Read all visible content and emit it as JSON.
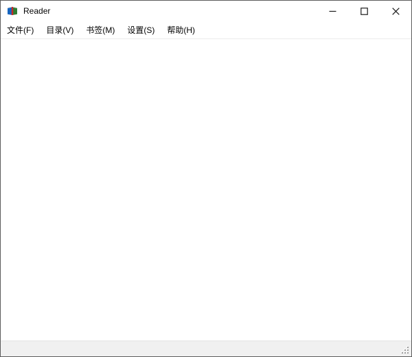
{
  "window": {
    "title": "Reader",
    "app_icon": "book-icon"
  },
  "titlebar": {
    "controls": [
      {
        "name": "minimize",
        "icon": "minimize-icon"
      },
      {
        "name": "maximize",
        "icon": "maximize-icon"
      },
      {
        "name": "close",
        "icon": "close-icon"
      }
    ]
  },
  "menubar": {
    "items": [
      {
        "label": "文件(F)"
      },
      {
        "label": "目录(V)"
      },
      {
        "label": "书签(M)"
      },
      {
        "label": "设置(S)"
      },
      {
        "label": "帮助(H)"
      }
    ]
  },
  "statusbar": {
    "grip_icon": "resize-grip-icon"
  },
  "colors": {
    "window_border": "#5b5b5b",
    "titlebar_bg": "#ffffff",
    "menubar_bg": "#ffffff",
    "content_bg": "#ffffff",
    "statusbar_bg": "#f0f0f0",
    "menu_separator": "#ececec",
    "glyph": "#1a1a1a",
    "book_blue": "#1565c0",
    "book_green": "#2e7d32",
    "book_red": "#c62828"
  }
}
